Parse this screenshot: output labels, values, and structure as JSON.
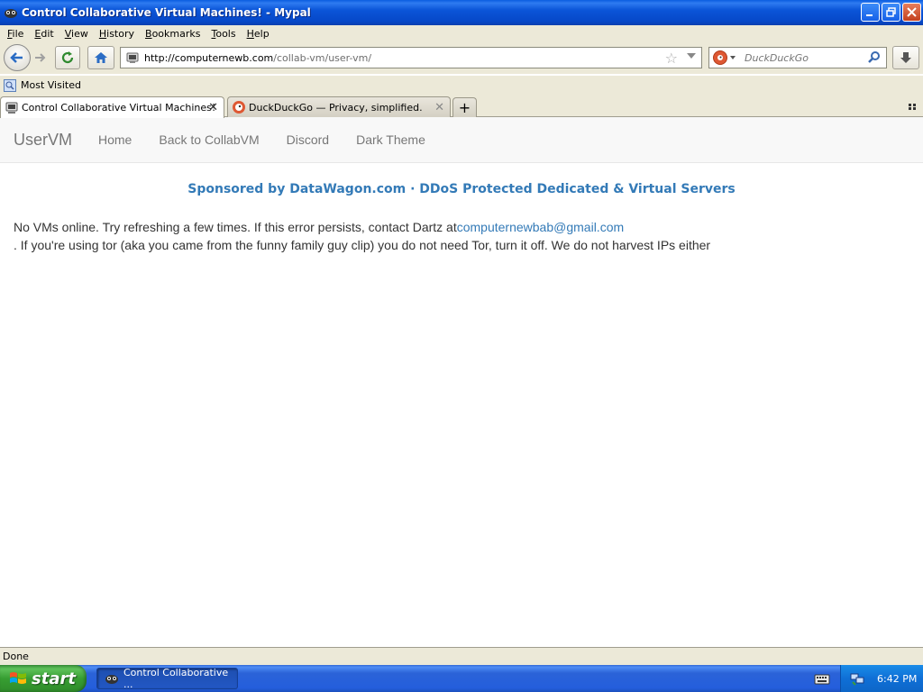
{
  "window": {
    "title": "Control Collaborative Virtual Machines! - Mypal"
  },
  "menu": {
    "items": [
      "File",
      "Edit",
      "View",
      "History",
      "Bookmarks",
      "Tools",
      "Help"
    ]
  },
  "navigation": {
    "url_host": "http://computernewb.com",
    "url_path": "/collab-vm/user-vm/",
    "search_placeholder": "DuckDuckGo"
  },
  "bookmarks": {
    "items": [
      {
        "label": "Most Visited"
      }
    ]
  },
  "tabs": [
    {
      "label": "Control Collaborative Virtual Machines!",
      "active": true
    },
    {
      "label": "DuckDuckGo — Privacy, simplified.",
      "active": false
    }
  ],
  "page": {
    "brand": "UserVM",
    "nav_links": [
      "Home",
      "Back to CollabVM",
      "Discord",
      "Dark Theme"
    ],
    "sponsor": "Sponsored by DataWagon.com · DDoS Protected Dedicated & Virtual Servers",
    "message_part1": "No VMs online. Try refreshing a few times. If this error persists, contact Dartz at",
    "message_email": "computernewbab@gmail.com",
    "message_part2": ". If you're using tor (aka you came from the funny family guy clip) you do not need Tor, turn it off. We do not harvest IPs either"
  },
  "status": {
    "text": "Done"
  },
  "taskbar": {
    "start_label": "start",
    "task_item_label": "Control Collaborative ...",
    "clock": "6:42 PM"
  },
  "colors": {
    "link": "#337ab7",
    "navbar_bg": "#f8f8f8",
    "xp_chrome": "#ece9d8"
  }
}
